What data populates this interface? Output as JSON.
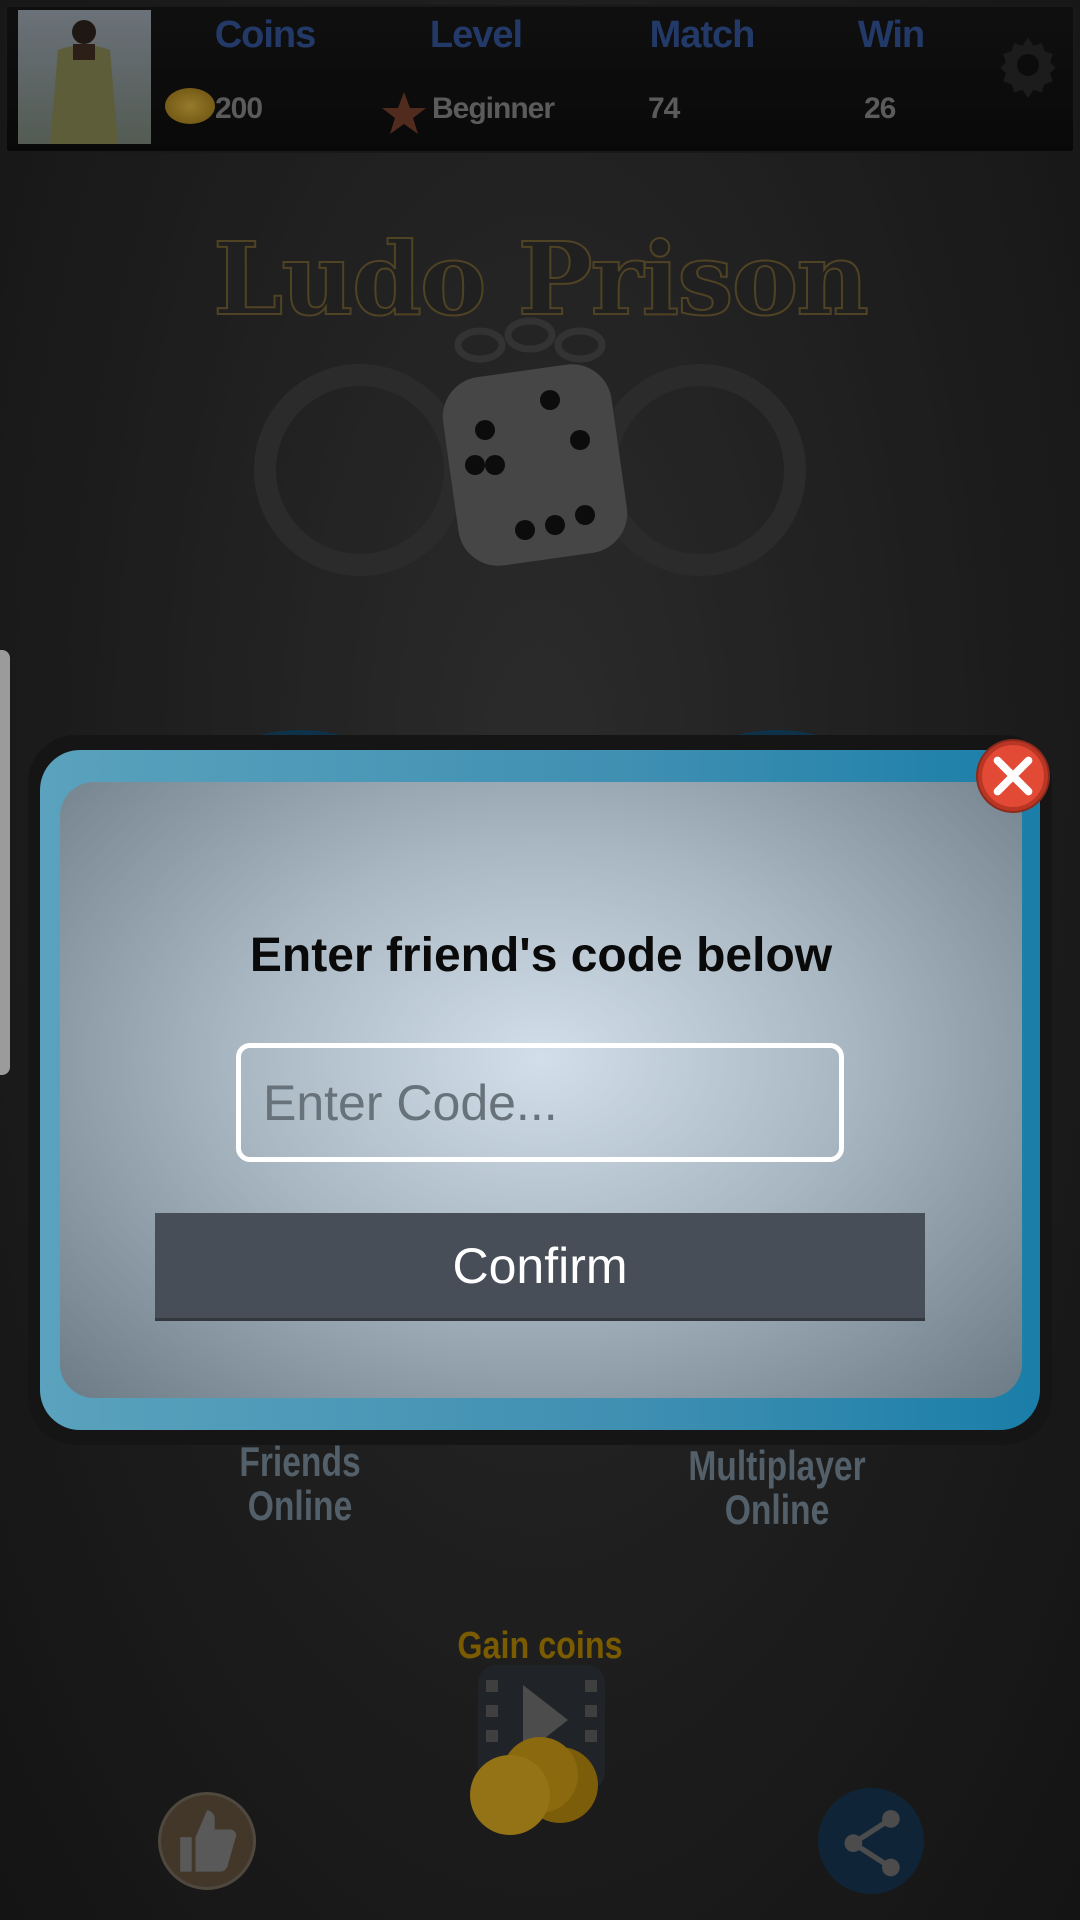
{
  "header": {
    "stats": [
      {
        "label": "Coins",
        "value": "200",
        "icon": "coin-icon"
      },
      {
        "label": "Level",
        "value": "Beginner",
        "icon": "star-icon"
      },
      {
        "label": "Match",
        "value": "74"
      },
      {
        "label": "Win",
        "value": "26"
      }
    ],
    "settings_icon": "gear-icon"
  },
  "logo": {
    "title": "Ludo Prison"
  },
  "menu": {
    "friends_online": [
      "Friends",
      "Online"
    ],
    "multiplayer_online": [
      "Multiplayer",
      "Online"
    ]
  },
  "gain_coins": {
    "label": "Gain coins"
  },
  "dialog": {
    "title": "Enter friend's code below",
    "input_placeholder": "Enter Code...",
    "input_value": "",
    "confirm_label": "Confirm"
  },
  "colors": {
    "accent": "#2f4e8c",
    "dialog_border": "#3f8fb2",
    "close": "#e24a35",
    "gold": "#a37a00"
  }
}
